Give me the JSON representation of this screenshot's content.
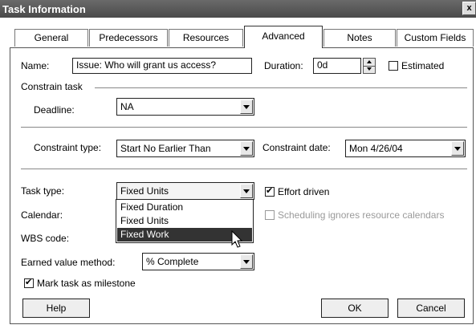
{
  "window": {
    "title": "Task Information",
    "close_glyph": "x"
  },
  "tabs": [
    {
      "label": "General"
    },
    {
      "label": "Predecessors"
    },
    {
      "label": "Resources"
    },
    {
      "label": "Advanced",
      "active": true
    },
    {
      "label": "Notes"
    },
    {
      "label": "Custom Fields"
    }
  ],
  "form": {
    "name": {
      "label": "Name:",
      "value": "Issue: Who will grant us access?"
    },
    "duration": {
      "label": "Duration:",
      "value": "0d"
    },
    "estimated": {
      "label": "Estimated",
      "checked": false
    },
    "constrain_task": {
      "label": "Constrain task"
    },
    "deadline": {
      "label": "Deadline:",
      "value": "NA"
    },
    "constraint_type": {
      "label": "Constraint type:",
      "value": "Start No Earlier Than"
    },
    "constraint_date": {
      "label": "Constraint date:",
      "value": "Mon 4/26/04"
    },
    "task_type": {
      "label": "Task type:",
      "value": "Fixed Units",
      "options": [
        "Fixed Duration",
        "Fixed Units",
        "Fixed Work"
      ],
      "highlighted": "Fixed Work"
    },
    "effort_driven": {
      "label": "Effort driven",
      "checked": true
    },
    "calendar": {
      "label": "Calendar:"
    },
    "scheduling_ignores": {
      "label": "Scheduling ignores resource calendars",
      "checked": false,
      "enabled": false
    },
    "wbs_code": {
      "label": "WBS code:"
    },
    "earned_value": {
      "label": "Earned value method:",
      "value": "% Complete"
    },
    "milestone": {
      "label": "Mark task as milestone",
      "checked": true
    }
  },
  "buttons": {
    "help": "Help",
    "ok": "OK",
    "cancel": "Cancel"
  },
  "colors": {
    "titlebar": "#555555",
    "highlight": "#333333"
  },
  "icons": {
    "cursor": "arrow-pointer-icon"
  }
}
